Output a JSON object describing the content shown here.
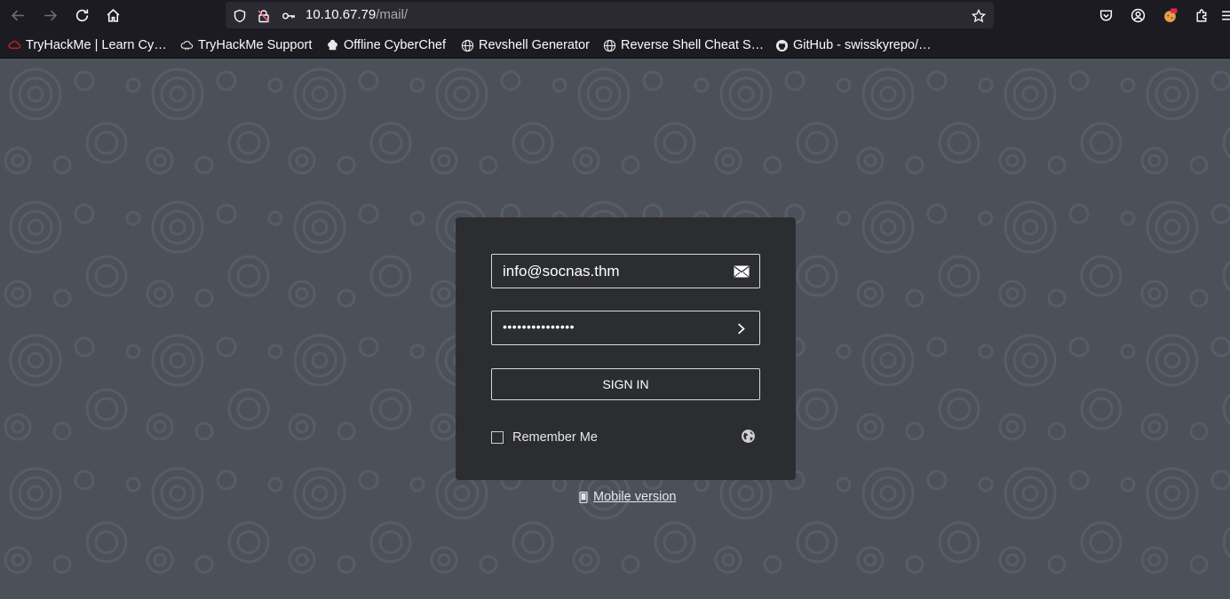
{
  "browser": {
    "url_host": "10.10.67.79",
    "url_path": "/mail/",
    "bookmarks": [
      {
        "label": "TryHackMe | Learn Cy…",
        "icon": "tryhackme-icon"
      },
      {
        "label": "TryHackMe Support",
        "icon": "cloud-icon"
      },
      {
        "label": "Offline CyberChef",
        "icon": "chef-hat-icon"
      },
      {
        "label": "Revshell Generator",
        "icon": "globe-icon"
      },
      {
        "label": "Reverse Shell Cheat S…",
        "icon": "globe-icon"
      },
      {
        "label": "GitHub - swisskyrepo/…",
        "icon": "github-icon"
      }
    ]
  },
  "login": {
    "username_value": "info@socnas.thm",
    "password_mask": "•••••••••••••••",
    "signin_label": "SIGN IN",
    "remember_label": "Remember Me",
    "remember_checked": false,
    "mobile_label": "Mobile version"
  },
  "colors": {
    "background": "#4b5059",
    "login_box": "#2c2d31",
    "chrome": "#1c1b22"
  }
}
